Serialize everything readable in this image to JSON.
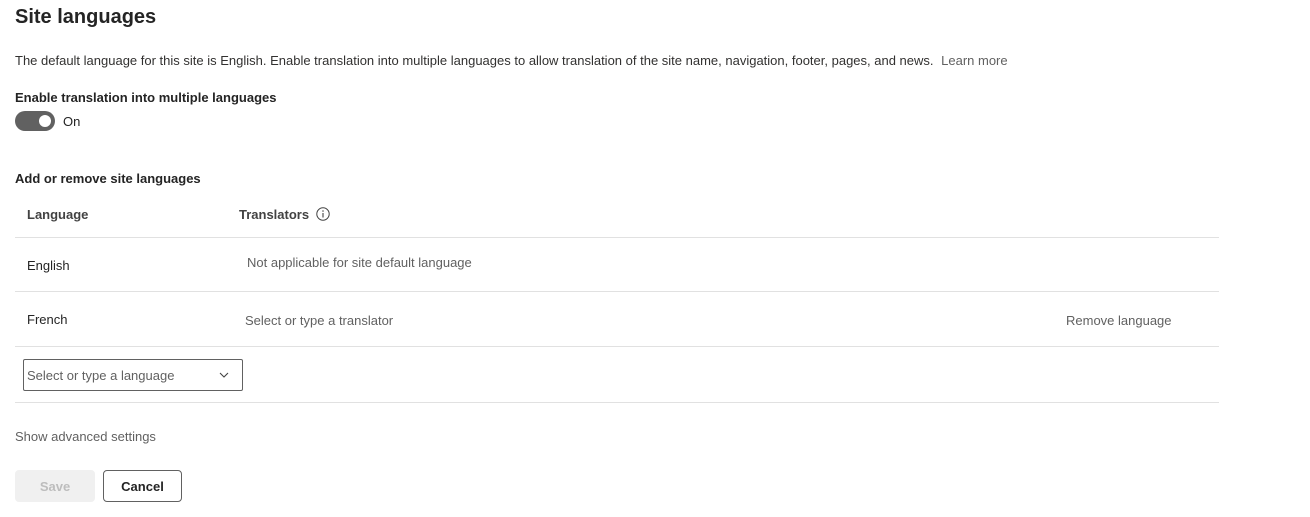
{
  "header": {
    "title": "Site languages",
    "description": "The default language for this site is English. Enable translation into multiple languages to allow translation of the site name, navigation, footer, pages, and news.",
    "learn_more": "Learn more"
  },
  "translation_toggle": {
    "label": "Enable translation into multiple languages",
    "state": "On",
    "enabled": true
  },
  "languages_section": {
    "title": "Add or remove site languages",
    "columns": {
      "language": "Language",
      "translators": "Translators"
    },
    "rows": [
      {
        "language": "English",
        "translators": "Not applicable for site default language"
      },
      {
        "language": "French",
        "translators_placeholder": "Select or type a translator",
        "action": "Remove language"
      }
    ],
    "add_language_placeholder": "Select or type a language"
  },
  "advanced": {
    "label": "Show advanced settings"
  },
  "buttons": {
    "save": "Save",
    "cancel": "Cancel"
  },
  "icons": {
    "info": "info-icon",
    "chevron": "chevron-down-icon"
  },
  "colors": {
    "toggle_on": "#616161",
    "divider": "#e1e1e1",
    "muted_text": "#616161"
  }
}
